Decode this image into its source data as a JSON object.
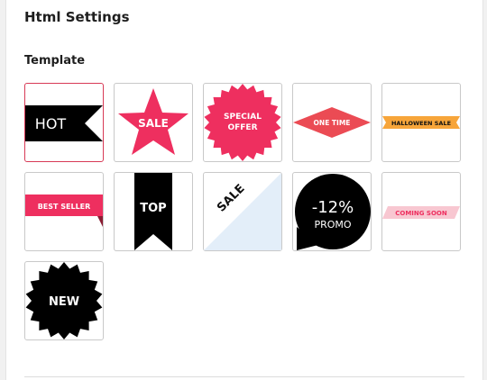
{
  "header": {
    "title": "Html Settings"
  },
  "section": {
    "label": "Template"
  },
  "templates": [
    {
      "text": "HOT",
      "selected": true
    },
    {
      "text": "SALE"
    },
    {
      "line1": "SPECIAL",
      "line2": "OFFER"
    },
    {
      "text": "ONE TIME"
    },
    {
      "text": "HALLOWEEN SALE"
    },
    {
      "text": "BEST SELLER"
    },
    {
      "text": "TOP"
    },
    {
      "text": "SALE"
    },
    {
      "line1": "-12%",
      "line2": "PROMO"
    },
    {
      "text": "COMING SOON"
    },
    {
      "text": "NEW"
    }
  ],
  "colors": {
    "accent": "#d83a56",
    "pink": "#ee2f5f",
    "coral": "#eb4b54",
    "orange": "#f7a53a",
    "light_blue": "#e3eef9",
    "light_pink": "#f8c7d1",
    "black": "#000000"
  }
}
